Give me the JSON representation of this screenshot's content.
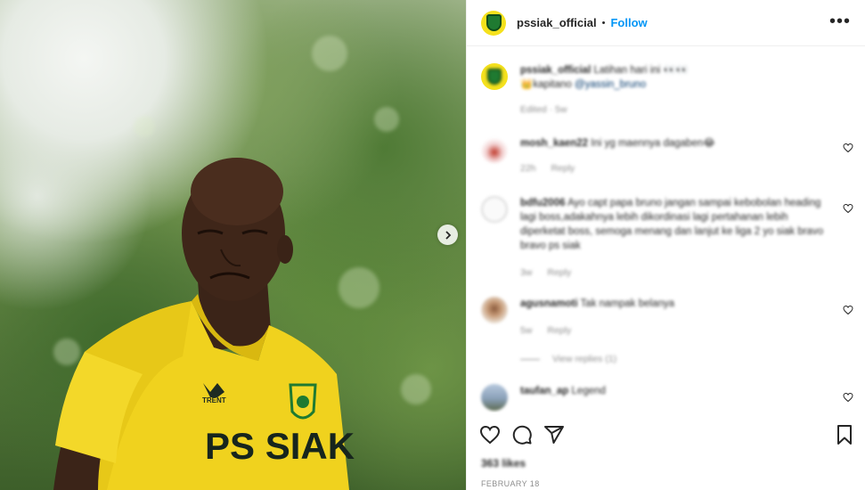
{
  "post": {
    "username": "pssiak_official",
    "separator": "•",
    "follow_label": "Follow",
    "more_label": "•••",
    "jersey_brand": "TRENT",
    "jersey_text": "PS SIAK",
    "carousel_next_icon": "chevron-right-icon"
  },
  "caption": {
    "username": "pssiak_official",
    "text": "Latihan hari ini 👀👀",
    "text2": "👑kapitano",
    "mention": "@yassin_bruno",
    "meta": "Edited · 5w"
  },
  "comments": [
    {
      "username": "mosh_kaen22",
      "text": "Ini yg maennya dagaben😂",
      "time": "22h",
      "reply_label": "Reply"
    },
    {
      "username": "bdfu2006",
      "text": "Ayo capt papa bruno jangan sampai kebobolan heading lagi boss,adakahnya lebih dikordinasi lagi pertahanan lebih diperketat boss, semoga menang dan lanjut ke liga 2 yo siak bravo bravo ps siak",
      "time": "3w",
      "reply_label": "Reply"
    },
    {
      "username": "agusnamoti",
      "text": "Tak nampak belanya",
      "time": "5w",
      "reply_label": "Reply",
      "view_replies": "View replies (1)"
    },
    {
      "username": "taufan_ap",
      "text": "Legend",
      "time": "",
      "reply_label": ""
    }
  ],
  "footer": {
    "likes": "363 likes",
    "date": "FEBRUARY 18"
  },
  "colors": {
    "accent": "#0095f6",
    "club_yellow": "#f5e11d",
    "club_green": "#1f7a31"
  }
}
